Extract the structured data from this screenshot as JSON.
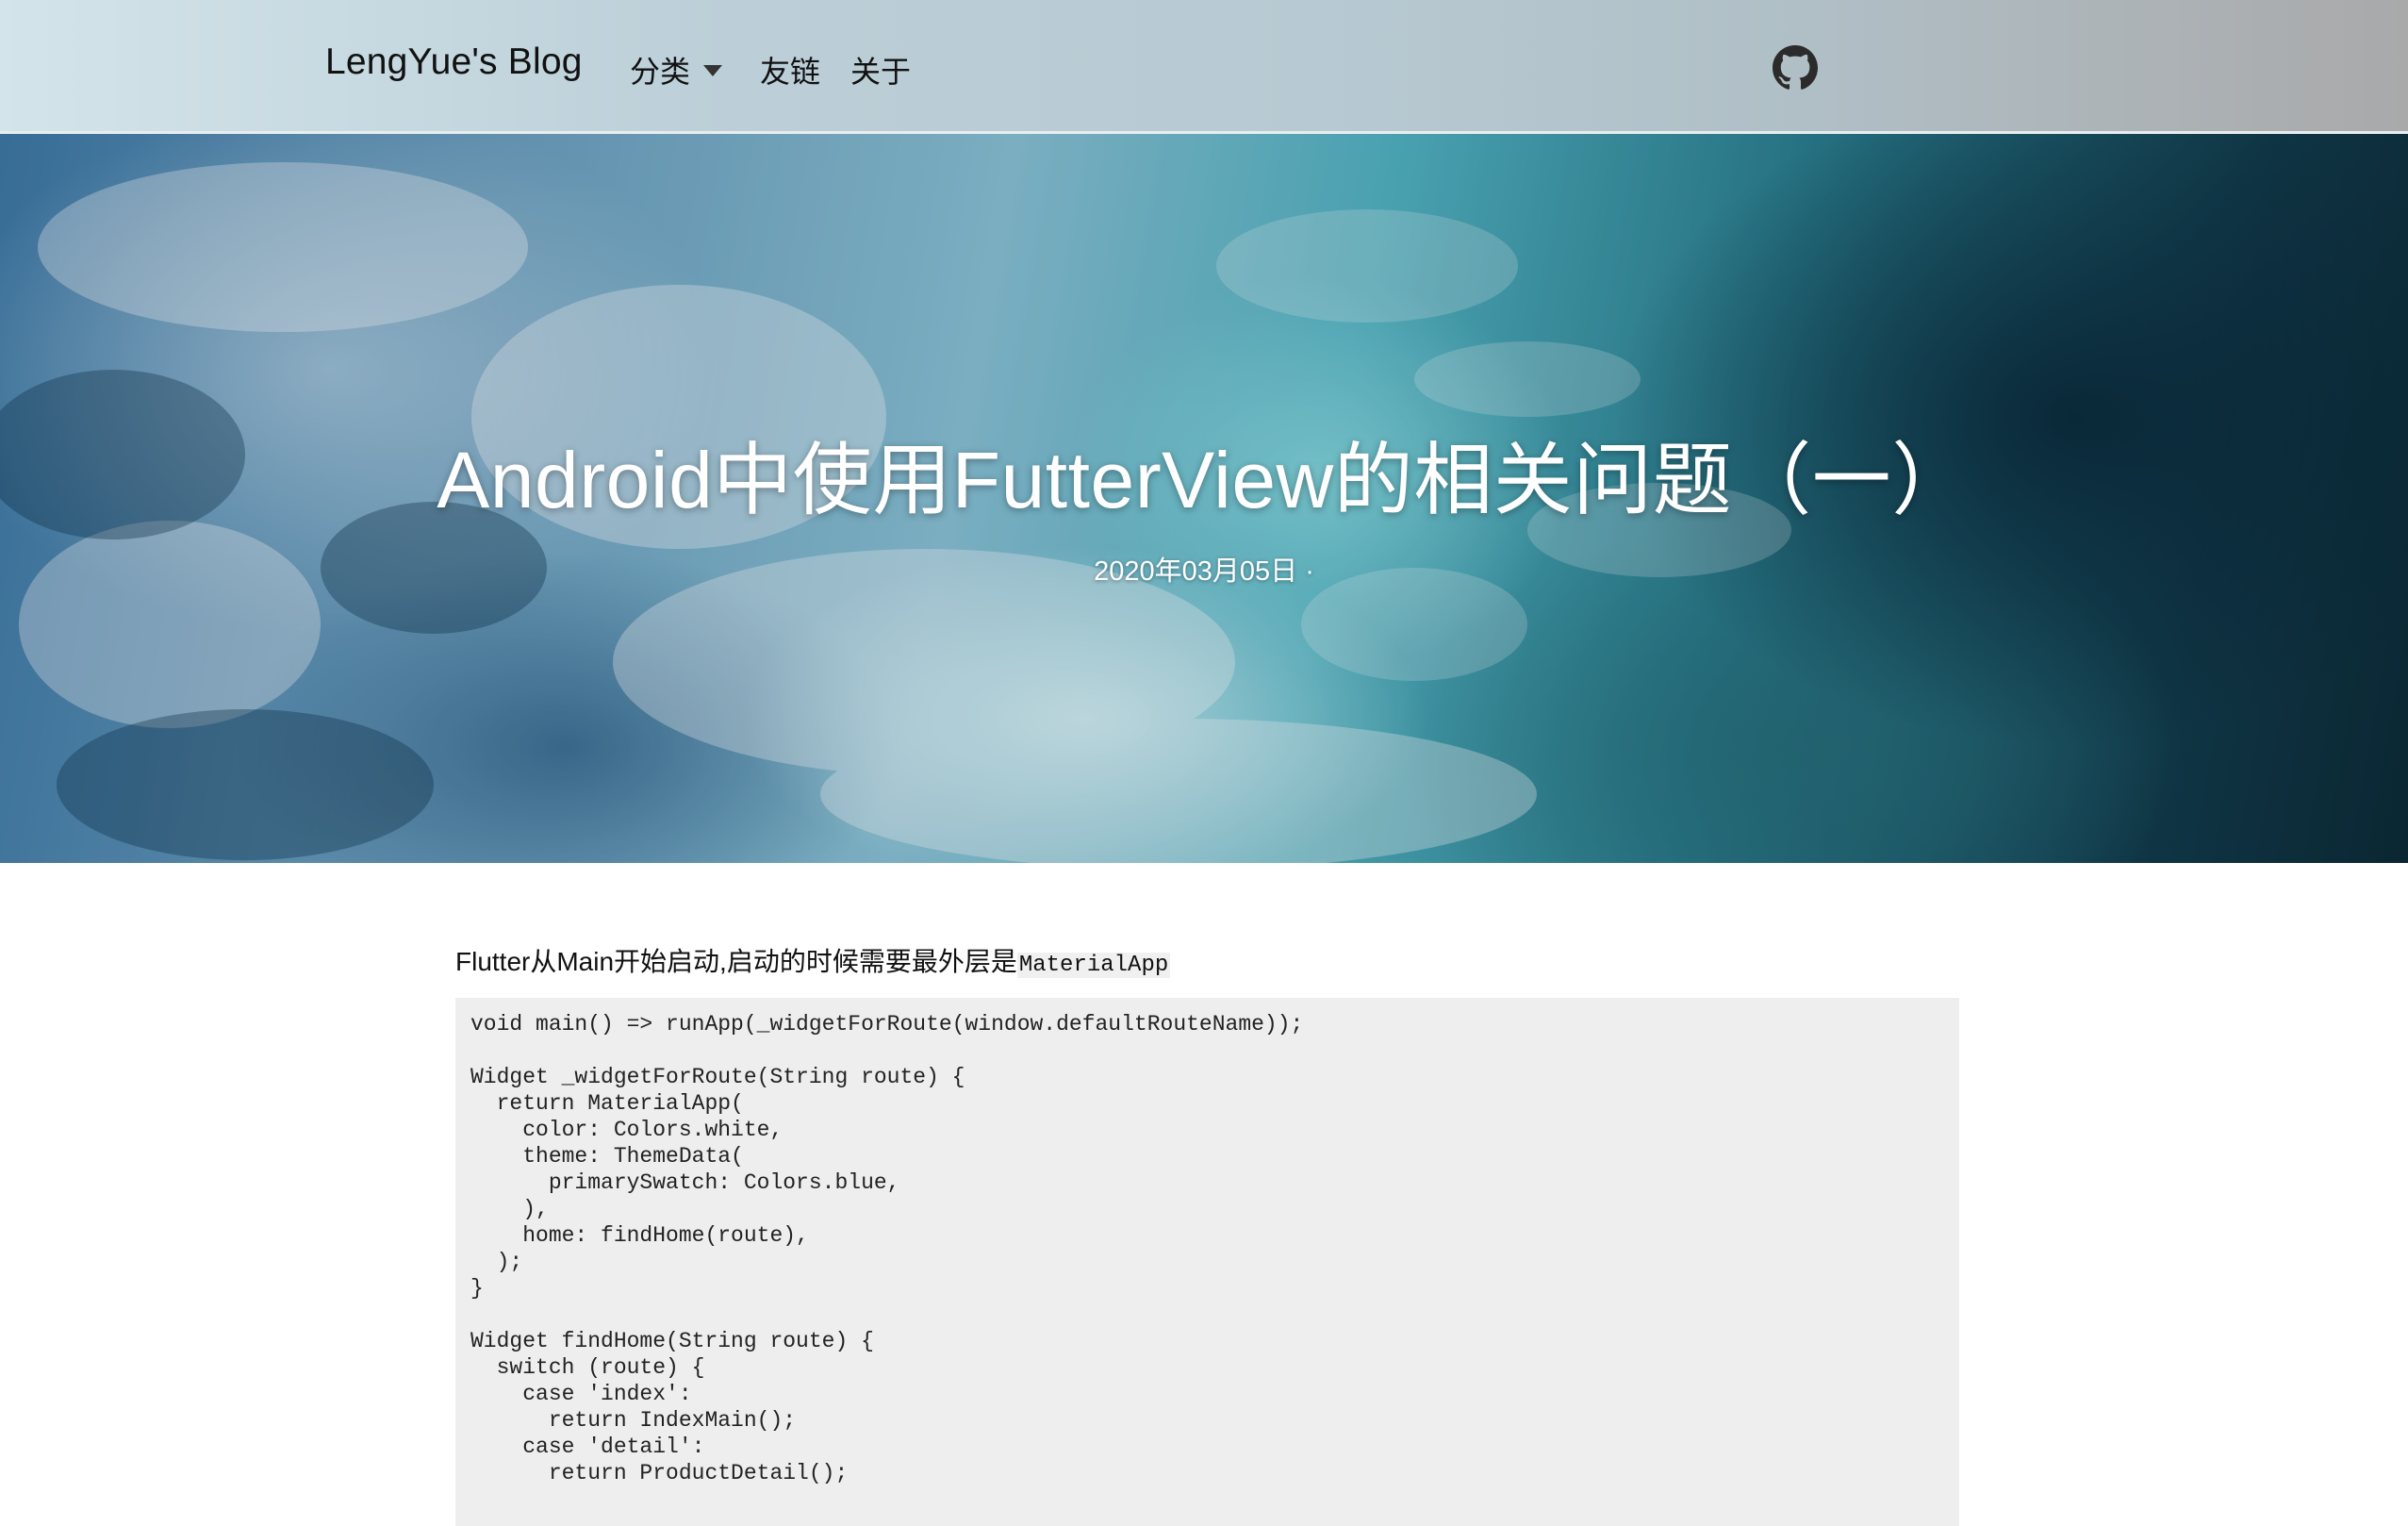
{
  "navbar": {
    "brand": "LengYue's Blog",
    "items": [
      {
        "label": "分类",
        "has_dropdown": true
      },
      {
        "label": "友链",
        "has_dropdown": false
      },
      {
        "label": "关于",
        "has_dropdown": false
      }
    ],
    "github_icon": "github-icon"
  },
  "hero": {
    "title": "Android中使用FutterView的相关问题（一）",
    "meta": "2020年03月05日 ·"
  },
  "article": {
    "intro_text": "Flutter从Main开始启动,启动的时候需要最外层是",
    "intro_code": "MaterialApp",
    "code_lines": [
      "void main() => runApp(_widgetForRoute(window.defaultRouteName));",
      "",
      "Widget _widgetForRoute(String route) {",
      "  return MaterialApp(",
      "    color: Colors.white,",
      "    theme: ThemeData(",
      "      primarySwatch: Colors.blue,",
      "    ),",
      "    home: findHome(route),",
      "  );",
      "}",
      "",
      "Widget findHome(String route) {",
      "  switch (route) {",
      "    case 'index':",
      "      return IndexMain();",
      "    case 'detail':",
      "      return ProductDetail();"
    ]
  },
  "colors": {
    "code_background": "#eeeeee",
    "text": "#111111"
  }
}
